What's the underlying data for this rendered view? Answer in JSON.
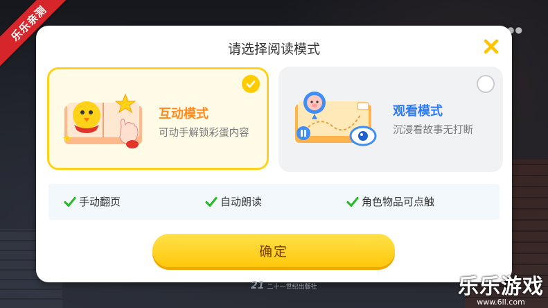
{
  "dialog": {
    "title": "请选择阅读模式",
    "modes": [
      {
        "title": "互动模式",
        "description": "可动手解锁彩蛋内容",
        "selected": true
      },
      {
        "title": "观看模式",
        "description": "沉浸看故事无打断",
        "selected": false
      }
    ],
    "features": [
      "手动翻页",
      "自动朗读",
      "角色物品可点触"
    ],
    "confirm_label": "确定"
  },
  "publisher": {
    "badge": "21",
    "name": "二十一世纪出版社"
  },
  "watermark": {
    "ribbon": "乐乐亲测",
    "brand": "乐乐游戏",
    "url": "www.6ll.com"
  },
  "colors": {
    "accent_yellow": "#ffcc00",
    "interactive_title": "#ff8a1f",
    "watch_title": "#2d7bf3",
    "check_green": "#2eb82e"
  }
}
